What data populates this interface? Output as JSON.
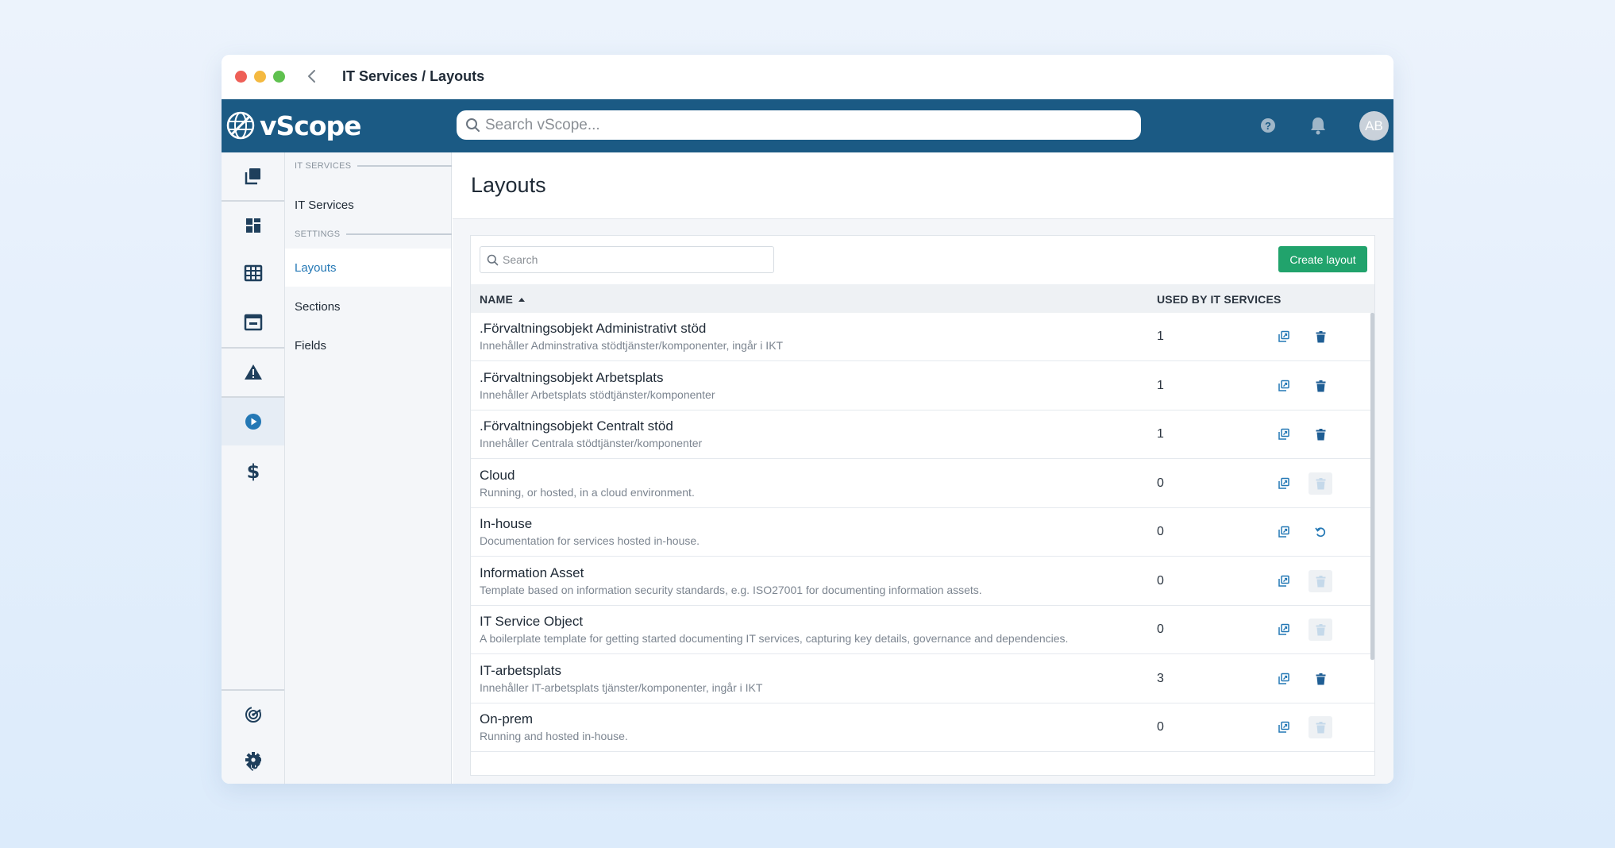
{
  "window": {
    "title": "IT Services / Layouts"
  },
  "topnav": {
    "logo_text": "vScope",
    "search_placeholder": "Search vScope...",
    "avatar_initials": "AB"
  },
  "icon_rail": {
    "items": [
      "cards-icon",
      "dashboard-icon",
      "table-icon",
      "window-icon",
      "warning-icon",
      "play-icon",
      "dollar-icon"
    ],
    "bottom_items": [
      "radar-icon",
      "tag-gear-icon",
      "gear-icon"
    ],
    "active": "play-icon"
  },
  "subnav": {
    "section_it_services": "IT SERVICES",
    "it_services_label": "IT Services",
    "section_settings": "SETTINGS",
    "items": [
      {
        "label": "Layouts",
        "active": true
      },
      {
        "label": "Sections",
        "active": false
      },
      {
        "label": "Fields",
        "active": false
      }
    ]
  },
  "main": {
    "page_title": "Layouts",
    "table_search_placeholder": "Search",
    "create_button_label": "Create layout",
    "columns": {
      "name": "NAME",
      "used_by": "USED BY IT SERVICES"
    },
    "rows": [
      {
        "name": ".Förvaltningsobjekt Administrativt stöd",
        "description": "Innehåller Adminstrativa stödtjänster/komponenter, ingår i IKT",
        "used_by": "1",
        "action": "delete"
      },
      {
        "name": ".Förvaltningsobjekt Arbetsplats",
        "description": "Innehåller Arbetsplats stödtjänster/komponenter",
        "used_by": "1",
        "action": "delete"
      },
      {
        "name": ".Förvaltningsobjekt Centralt stöd",
        "description": "Innehåller Centrala stödtjänster/komponenter",
        "used_by": "1",
        "action": "delete"
      },
      {
        "name": "Cloud",
        "description": "Running, or hosted, in a cloud environment.",
        "used_by": "0",
        "action": "delete-disabled"
      },
      {
        "name": "In-house",
        "description": "Documentation for services hosted in-house.",
        "used_by": "0",
        "action": "restore"
      },
      {
        "name": "Information Asset",
        "description": "Template based on information security standards, e.g. ISO27001 for documenting information assets.",
        "used_by": "0",
        "action": "delete-disabled"
      },
      {
        "name": "IT Service Object",
        "description": "A boilerplate template for getting started documenting IT services, capturing key details, governance and dependencies.",
        "used_by": "0",
        "action": "delete-disabled"
      },
      {
        "name": "IT-arbetsplats",
        "description": "Innehåller IT-arbetsplats tjänster/komponenter, ingår i IKT",
        "used_by": "3",
        "action": "delete"
      },
      {
        "name": "On-prem",
        "description": "Running and hosted in-house.",
        "used_by": "0",
        "action": "delete-disabled"
      }
    ]
  },
  "colors": {
    "nav_bar": "#1b5a84",
    "accent_blue": "#2478b5",
    "create_green": "#21a36c",
    "disabled_icon": "#c5d9ea"
  }
}
